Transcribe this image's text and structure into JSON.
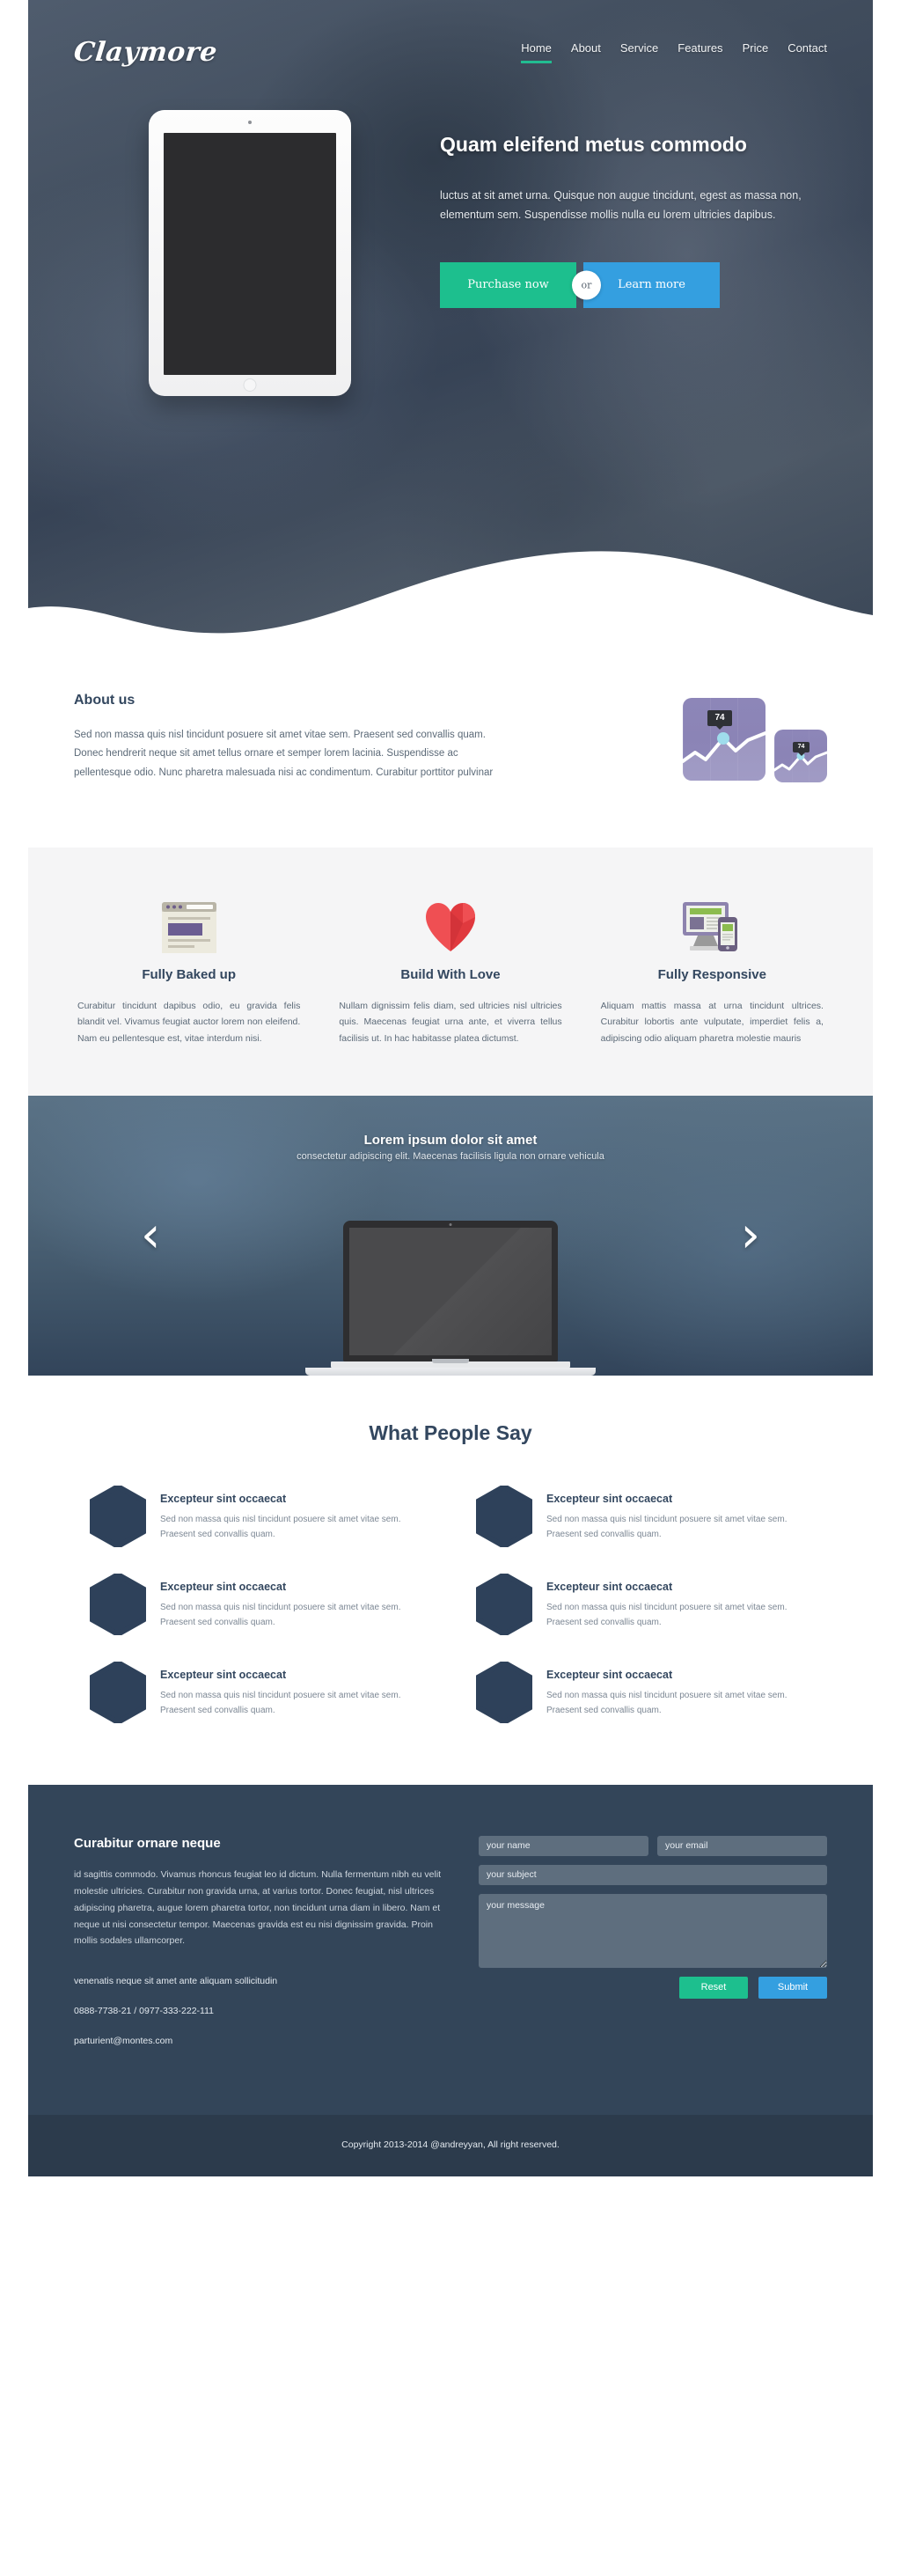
{
  "brand": {
    "name": "Claymore"
  },
  "nav": {
    "items": [
      {
        "label": "Home",
        "active": true
      },
      {
        "label": "About",
        "active": false
      },
      {
        "label": "Service",
        "active": false
      },
      {
        "label": "Features",
        "active": false
      },
      {
        "label": "Price",
        "active": false
      },
      {
        "label": "Contact",
        "active": false
      }
    ]
  },
  "hero": {
    "title": "Quam eleifend metus commodo",
    "description": "luctus at sit amet urna. Quisque non augue tincidunt, egest as massa non, elementum sem. Suspendisse mollis nulla eu lorem ultricies dapibus.",
    "primary_button": "Purchase now",
    "or_label": "or",
    "secondary_button": "Learn more"
  },
  "about": {
    "title": "About us",
    "text": "Sed non massa quis nisl tincidunt posuere sit amet vitae sem. Praesent sed convallis quam. Donec hendrerit neque sit amet tellus ornare et semper lorem lacinia. Suspendisse ac pellentesque odio. Nunc pharetra malesuada nisi ac condimentum. Curabitur porttitor pulvinar",
    "chart_big_value": "74",
    "chart_small_value": "74"
  },
  "features": [
    {
      "icon": "browser-window-icon",
      "title": "Fully Baked up",
      "text": "Curabitur tincidunt dapibus odio, eu gravida felis blandit vel. Vivamus feugiat auctor lorem non eleifend. Nam eu pellentesque est, vitae interdum nisi."
    },
    {
      "icon": "heart-icon",
      "title": "Build With Love",
      "text": "Nullam dignissim felis diam, sed ultricies nisl ultricies quis. Maecenas feugiat urna ante, et viverra tellus facilisis ut. In hac habitasse platea dictumst."
    },
    {
      "icon": "responsive-devices-icon",
      "title": "Fully Responsive",
      "text": "Aliquam mattis massa at urna tincidunt ultrices. Curabitur lobortis ante vulputate, imperdiet felis a, adipiscing odio aliquam pharetra molestie mauris"
    }
  ],
  "slider": {
    "title": "Lorem ipsum dolor sit amet",
    "subtitle": "consectetur adipiscing elit. Maecenas facilisis ligula non ornare vehicula",
    "prev_arrow": "‹",
    "next_arrow": "›"
  },
  "testimonials": {
    "heading": "What People Say",
    "items": [
      {
        "title": "Excepteur sint occaecat",
        "text": "Sed non massa quis nisl tincidunt posuere sit amet vitae sem. Praesent sed convallis quam."
      },
      {
        "title": "Excepteur sint occaecat",
        "text": "Sed non massa quis nisl tincidunt posuere sit amet vitae sem. Praesent sed convallis quam."
      },
      {
        "title": "Excepteur sint occaecat",
        "text": "Sed non massa quis nisl tincidunt posuere sit amet vitae sem. Praesent sed convallis quam."
      },
      {
        "title": "Excepteur sint occaecat",
        "text": "Sed non massa quis nisl tincidunt posuere sit amet vitae sem. Praesent sed convallis quam."
      },
      {
        "title": "Excepteur sint occaecat",
        "text": "Sed non massa quis nisl tincidunt posuere sit amet vitae sem. Praesent sed convallis quam."
      },
      {
        "title": "Excepteur sint occaecat",
        "text": "Sed non massa quis nisl tincidunt posuere sit amet vitae sem. Praesent sed convallis quam."
      }
    ]
  },
  "contact": {
    "title": "Curabitur ornare neque",
    "text": "id sagittis commodo. Vivamus rhoncus feugiat leo id dictum. Nulla fermentum nibh eu velit molestie ultricies. Curabitur non gravida urna, at varius tortor. Donec feugiat, nisl ultrices adipiscing pharetra, augue lorem pharetra tortor, non tincidunt urna diam in libero. Nam et neque ut nisi consectetur tempor. Maecenas gravida est eu nisi dignissim gravida. Proin mollis sodales ullamcorper.",
    "address": "venenatis neque sit amet ante aliquam sollicitudin",
    "phone": "0888-7738-21 / 0977-333-222-111",
    "email": "parturient@montes.com",
    "form": {
      "name_placeholder": "your name",
      "email_placeholder": "your email",
      "subject_placeholder": "your subject",
      "message_placeholder": "your message",
      "reset_label": "Reset",
      "submit_label": "Submit"
    }
  },
  "footer": {
    "copyright": "Copyright 2013-2014 @andreyyan, All right reserved."
  },
  "colors": {
    "accent_green": "#1dbf8e",
    "accent_blue": "#349fe0",
    "dark_navy": "#334559",
    "footer_navy": "#2c3b4c",
    "heading": "#33475f"
  }
}
